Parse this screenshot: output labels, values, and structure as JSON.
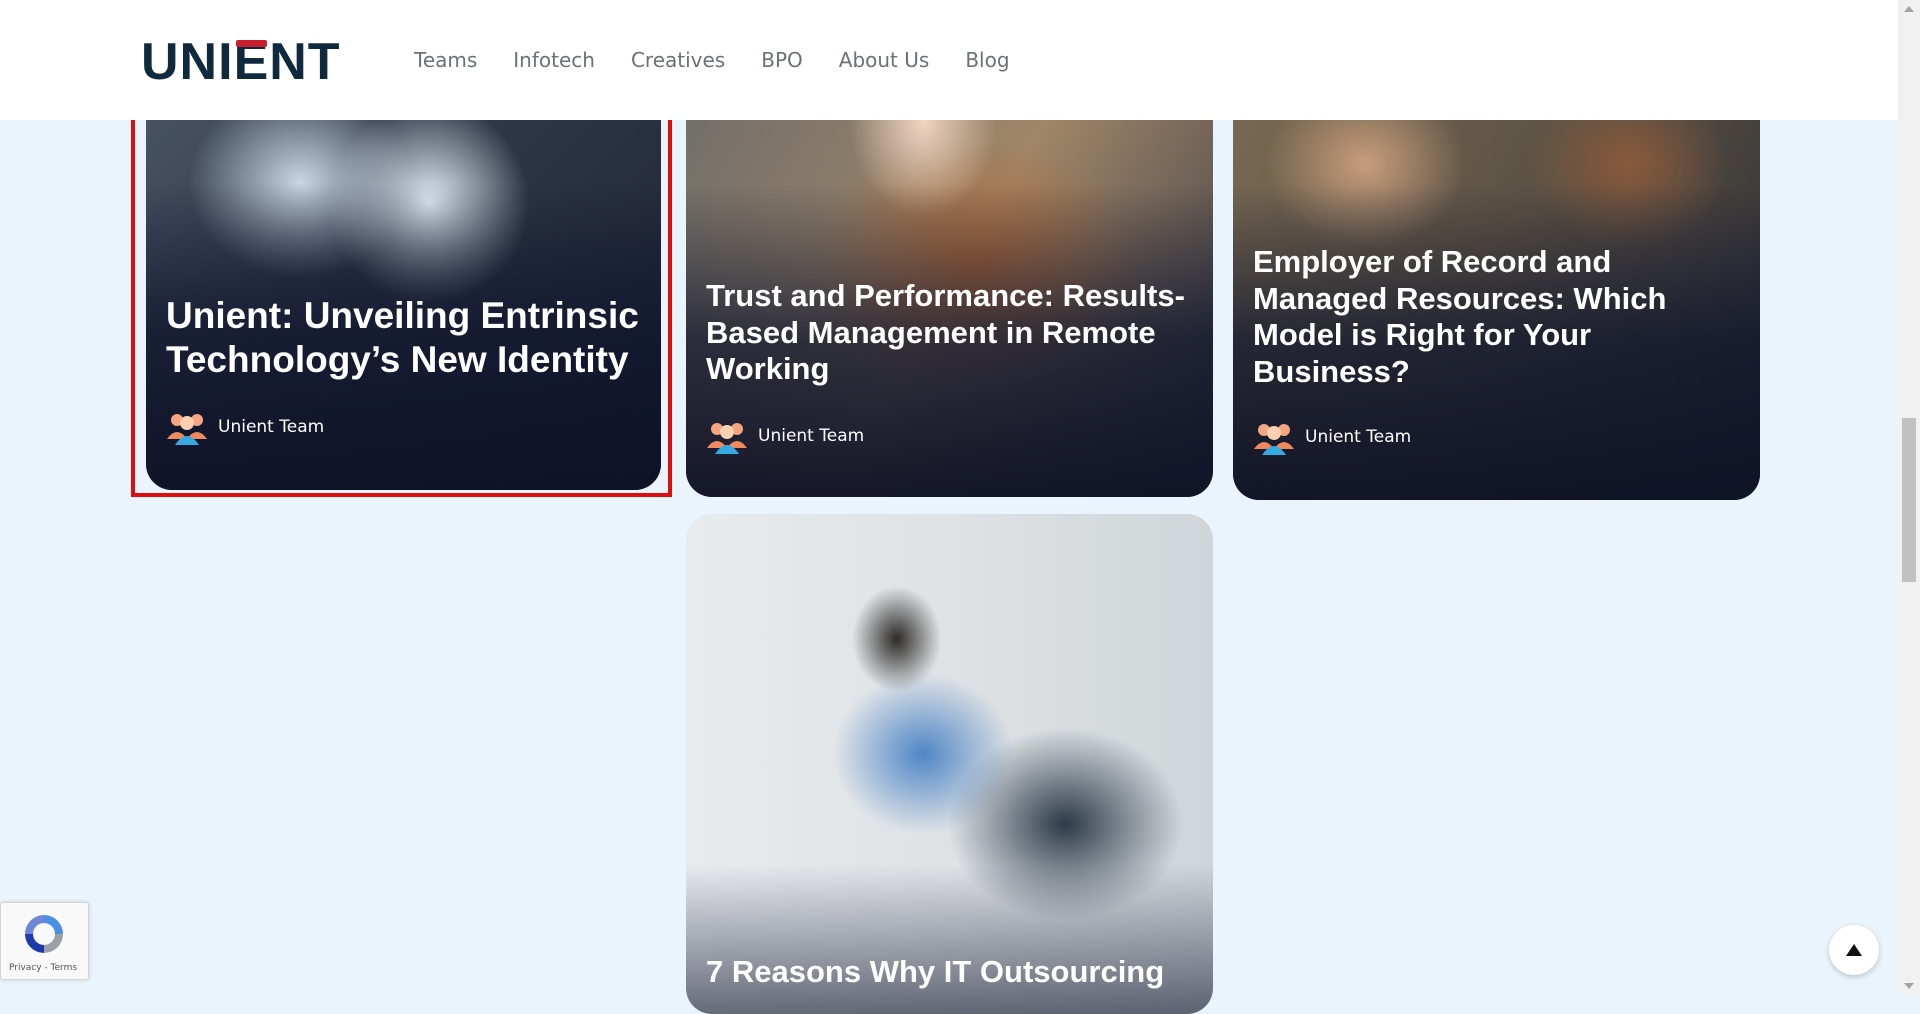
{
  "header": {
    "logo_text": "UNIENT",
    "nav": [
      {
        "label": "Teams"
      },
      {
        "label": "Infotech"
      },
      {
        "label": "Creatives"
      },
      {
        "label": "BPO"
      },
      {
        "label": "About Us"
      },
      {
        "label": "Blog"
      }
    ]
  },
  "posts": [
    {
      "title": "Unient: Unveiling Entrinsic Technology’s New Identity",
      "author": "Unient Team"
    },
    {
      "title": "Trust and Performance: Results-Based Management in Remote Working",
      "author": "Unient Team"
    },
    {
      "title": "Employer of Record and Managed Resources: Which Model is Right for Your Business?",
      "author": "Unient Team"
    },
    {
      "title": "7 Reasons Why IT Outsourcing"
    }
  ],
  "recaptcha": {
    "terms_text": "Privacy - Terms"
  },
  "colors": {
    "brand_navy": "#0f2a3d",
    "brand_red": "#c8202f",
    "page_bg": "#eaf4fc",
    "highlight": "#e00d0d"
  },
  "icons": {
    "author": "team-avatar-icon",
    "recaptcha": "recaptcha-icon",
    "back_to_top": "arrow-up-icon"
  }
}
